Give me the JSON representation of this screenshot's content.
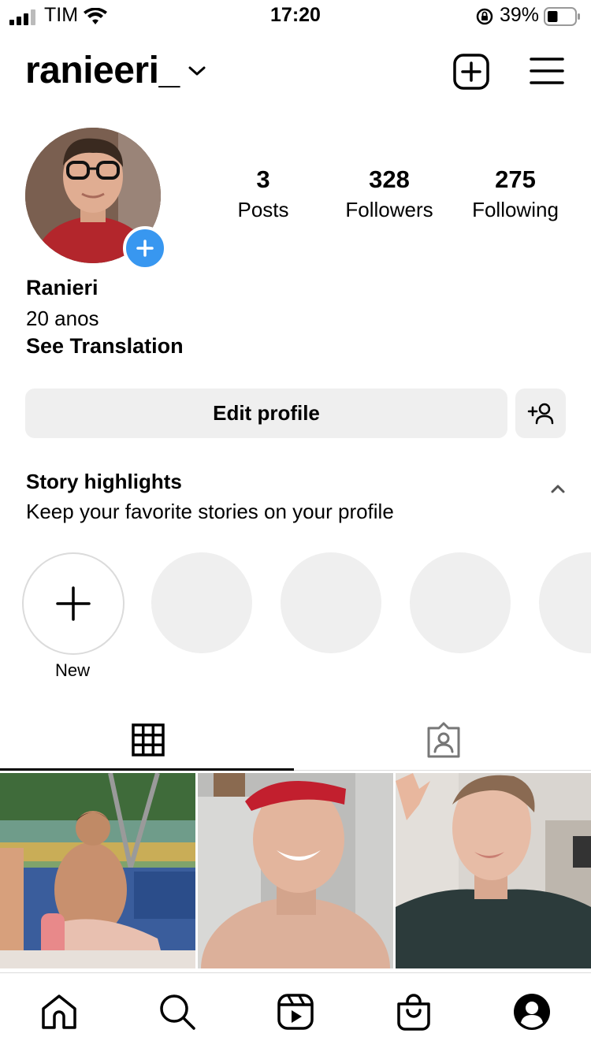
{
  "status_bar": {
    "carrier": "TIM",
    "time": "17:20",
    "battery_percent": "39%",
    "battery_level": 0.39
  },
  "header": {
    "username": "ranieeri_",
    "icons": [
      "chevron-down-icon",
      "new-post-icon",
      "menu-icon"
    ]
  },
  "profile": {
    "stats": [
      {
        "value": "3",
        "label": "Posts"
      },
      {
        "value": "328",
        "label": "Followers"
      },
      {
        "value": "275",
        "label": "Following"
      }
    ],
    "name": "Ranieri",
    "bio": "20 anos",
    "see_translation": "See Translation",
    "edit_profile_label": "Edit profile"
  },
  "highlights": {
    "title": "Story highlights",
    "subtitle": "Keep your favorite stories on your profile",
    "new_label": "New"
  },
  "tabs": [
    "grid-icon",
    "tagged-icon"
  ],
  "nav": [
    "home-icon",
    "search-icon",
    "reels-icon",
    "shop-icon",
    "profile-icon"
  ],
  "colors": {
    "accent": "#3897f0",
    "button_bg": "#efefef",
    "placeholder": "#efefef"
  }
}
